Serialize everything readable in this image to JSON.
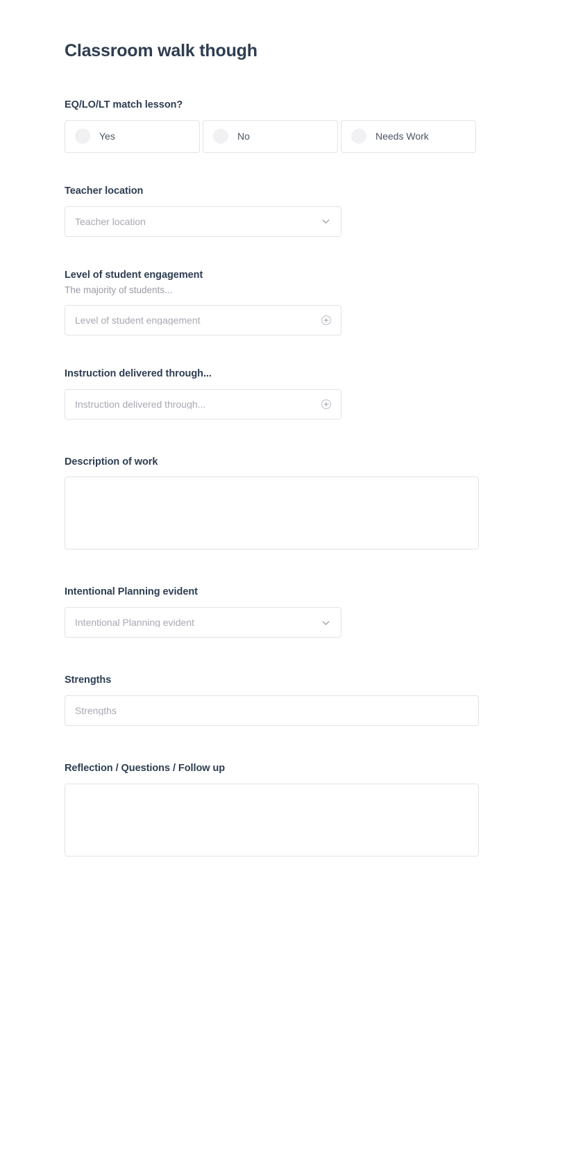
{
  "form": {
    "title": "Classroom walk though",
    "fields": [
      {
        "id": "eq-lo-lt-match-lesson",
        "label": "EQ/LO/LT match lesson?",
        "type": "radio",
        "options": [
          "Yes",
          "No",
          "Needs Work"
        ]
      },
      {
        "id": "teacher-location",
        "label": "Teacher location",
        "type": "select",
        "placeholder": "Teacher location",
        "value": "",
        "icon": "chevron-down-icon"
      },
      {
        "id": "level-of-student-engagement",
        "label": "Level of student engagement",
        "help": "The majority of students...",
        "type": "select",
        "placeholder": "Level of student engagement",
        "value": "",
        "icon": "plus-circle-icon"
      },
      {
        "id": "instruction-delivered-through",
        "label": "Instruction delivered through...",
        "type": "select",
        "placeholder": "Instruction delivered through...",
        "value": "",
        "icon": "plus-circle-icon"
      },
      {
        "id": "description-of-work",
        "label": "Description of work",
        "type": "textarea",
        "placeholder": "",
        "value": ""
      },
      {
        "id": "intentional-planning-evident",
        "label": "Intentional Planning evident",
        "type": "select",
        "placeholder": "Intentional Planning evident",
        "value": "",
        "icon": "chevron-down-icon"
      },
      {
        "id": "strengths",
        "label": "Strengths",
        "type": "text",
        "placeholder": "Strengths",
        "value": ""
      },
      {
        "id": "reflection-questions-follow-up",
        "label": "Reflection / Questions / Follow up",
        "type": "textarea",
        "placeholder": "",
        "value": ""
      }
    ]
  },
  "theme": {
    "label_color": "#2e3d51",
    "placeholder_color": "#a8a8b3",
    "help_color": "#9a9aa6",
    "border_color": "#e3e3e6",
    "radio_dot_color": "#f1f1f3",
    "background": "#ffffff"
  }
}
